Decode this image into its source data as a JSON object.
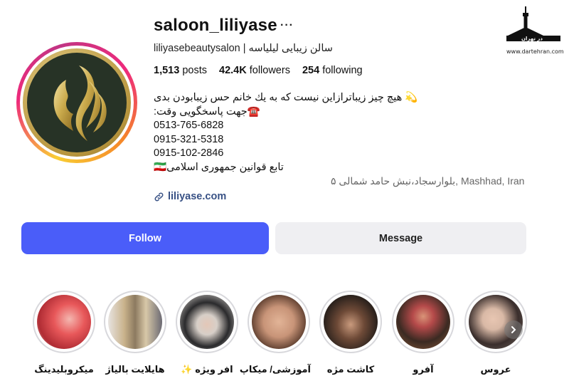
{
  "profile": {
    "username": "saloon_liliyase",
    "subtitle": "liliyasebeautysalon | سالن زیبایی لیلیاسه",
    "stats": {
      "posts_value": "1,513",
      "posts_label": "posts",
      "followers_value": "42.4K",
      "followers_label": "followers",
      "following_value": "254",
      "following_label": "following"
    },
    "bio": [
      "💫 هیچ چیز زیباترازاین نیست که به یك خانم حس زیبابودن بدی",
      "☎️جهت پاسخگویی وقت:",
      "0513-765-6828",
      "0915-321-5318",
      "0915-102-2846",
      "تابع قوانین جمهوری اسلامی🇮🇷"
    ],
    "location": "بلوارسجاد،نبش حامد شمالی ۵, Mashhad, Iran",
    "link": "liliyase.com"
  },
  "buttons": {
    "follow": "Follow",
    "message": "Message"
  },
  "highlights": [
    {
      "label": "میکروبلیدینگ",
      "color_a": "#e8585a",
      "color_b": "#f4b7b0"
    },
    {
      "label": "هایلایت بالیاژ",
      "color_a": "#c9b28b",
      "color_b": "#6b6a73"
    },
    {
      "label": "افر ویژه ✨",
      "color_a": "#2a2a2c",
      "color_b": "#d7cfc8"
    },
    {
      "label": "آموزشی/ میکاپ",
      "color_a": "#c89478",
      "color_b": "#5a3b2c"
    },
    {
      "label": "کاشت مژه",
      "color_a": "#2a211c",
      "color_b": "#c99a7d"
    },
    {
      "label": "آفرو",
      "color_a": "#3b2a22",
      "color_b": "#b54a4a"
    },
    {
      "label": "عروس",
      "color_a": "#3a2e2c",
      "color_b": "#d9b9a6"
    }
  ],
  "watermark": {
    "title": "در تهران",
    "url": "www.dartehran.com"
  },
  "colors": {
    "follow_bg": "#4a5df9",
    "message_bg": "#efeff2",
    "link": "#385185",
    "logo_gold": "#c9a94b",
    "logo_bg": "#273326"
  }
}
